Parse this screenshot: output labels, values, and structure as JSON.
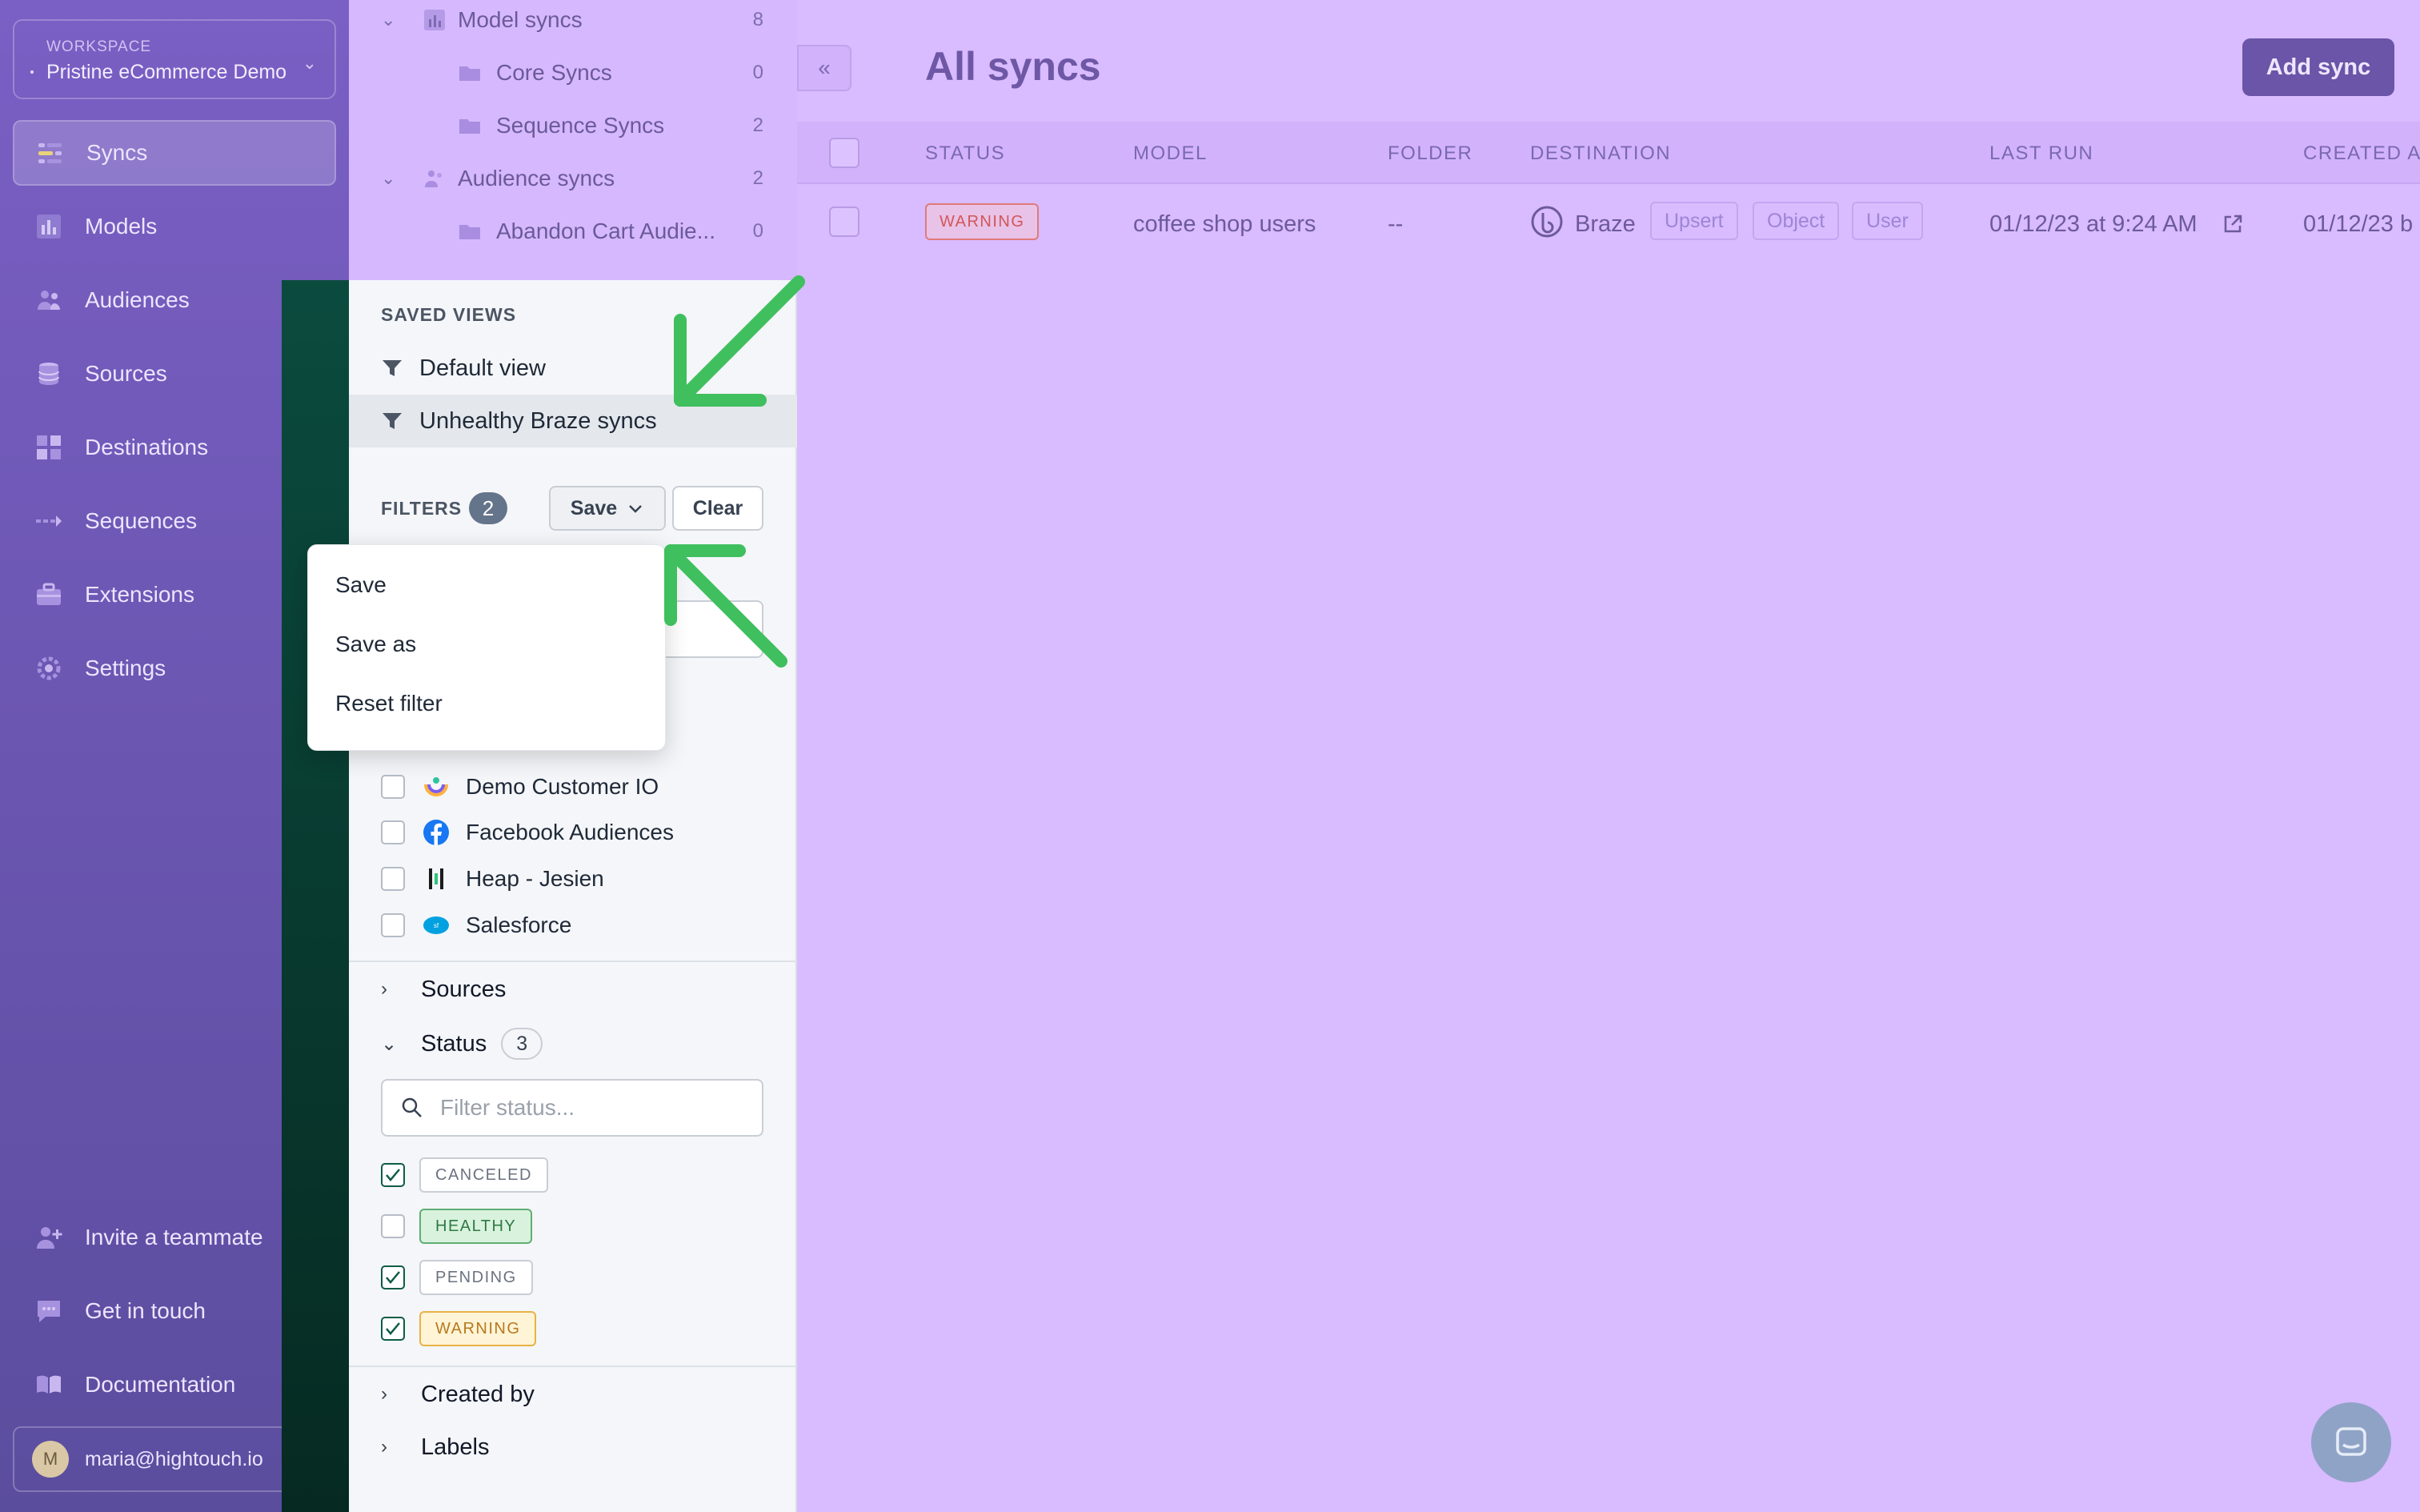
{
  "nav": {
    "workspace_label": "WORKSPACE",
    "workspace_name": "Pristine eCommerce Demo",
    "items": [
      {
        "label": "Syncs",
        "icon": "syncs-icon",
        "active": true
      },
      {
        "label": "Models",
        "icon": "bar-chart-icon"
      },
      {
        "label": "Audiences",
        "icon": "people-icon"
      },
      {
        "label": "Sources",
        "icon": "database-icon"
      },
      {
        "label": "Destinations",
        "icon": "grid-icon"
      },
      {
        "label": "Sequences",
        "icon": "sequence-arrow-icon"
      },
      {
        "label": "Extensions",
        "icon": "briefcase-icon"
      },
      {
        "label": "Settings",
        "icon": "gear-icon"
      }
    ],
    "bottom_items": [
      {
        "label": "Invite a teammate",
        "icon": "add-user-icon"
      },
      {
        "label": "Get in touch",
        "icon": "chat-bubble-icon"
      },
      {
        "label": "Documentation",
        "icon": "book-icon"
      }
    ],
    "user": {
      "initial": "M",
      "email": "maria@hightouch.io"
    }
  },
  "tree": {
    "items": [
      {
        "label": "Model syncs",
        "count": "8",
        "level": 0,
        "icon": "bar-chart-icon"
      },
      {
        "label": "Core Syncs",
        "count": "0",
        "level": 1,
        "icon": "folder-icon"
      },
      {
        "label": "Sequence Syncs",
        "count": "2",
        "level": 1,
        "icon": "folder-icon"
      },
      {
        "label": "Audience syncs",
        "count": "2",
        "level": 0,
        "icon": "people-icon"
      },
      {
        "label": "Abandon Cart Audie...",
        "count": "0",
        "level": 1,
        "icon": "folder-icon"
      }
    ]
  },
  "saved_views": {
    "heading": "SAVED VIEWS",
    "items": [
      {
        "label": "Default view",
        "selected": false
      },
      {
        "label": "Unhealthy Braze syncs",
        "selected": true
      }
    ]
  },
  "filters": {
    "heading": "FILTERS",
    "count": "2",
    "save_label": "Save",
    "clear_label": "Clear"
  },
  "save_menu": {
    "items": [
      "Save",
      "Save as",
      "Reset filter"
    ]
  },
  "destinations_list": [
    {
      "label": "Demo Customer IO",
      "icon": "customer-io-icon",
      "checked": false
    },
    {
      "label": "Facebook Audiences",
      "icon": "facebook-icon",
      "checked": false
    },
    {
      "label": "Heap - Jesien",
      "icon": "heap-icon",
      "checked": false
    },
    {
      "label": "Salesforce",
      "icon": "salesforce-icon",
      "checked": false
    }
  ],
  "sources_section": {
    "label": "Sources"
  },
  "status_section": {
    "label": "Status",
    "count": "3",
    "search_placeholder": "Filter status...",
    "options": [
      {
        "label": "CANCELED",
        "checked": true,
        "style": "neutral"
      },
      {
        "label": "HEALTHY",
        "checked": false,
        "style": "healthy"
      },
      {
        "label": "PENDING",
        "checked": true,
        "style": "neutral"
      },
      {
        "label": "WARNING",
        "checked": true,
        "style": "warning"
      }
    ]
  },
  "created_by_section": {
    "label": "Created by"
  },
  "labels_section": {
    "label": "Labels"
  },
  "main": {
    "collapse_label": "«",
    "title": "All syncs",
    "add_button": "Add sync",
    "columns": [
      "STATUS",
      "MODEL",
      "FOLDER",
      "DESTINATION",
      "LAST RUN",
      "CREATED AT"
    ],
    "rows": [
      {
        "status": "WARNING",
        "model": "coffee shop users",
        "folder": "--",
        "destination": "Braze",
        "tags": [
          "Upsert",
          "Object",
          "User"
        ],
        "last_run": "01/12/23 at 9:24 AM",
        "created_at": "01/12/23  b"
      }
    ]
  },
  "colors": {
    "accent": "#6a55a8",
    "annotation_arrow": "#3fbf5e",
    "warning": "#d15757",
    "healthy": "#2e7a43"
  }
}
